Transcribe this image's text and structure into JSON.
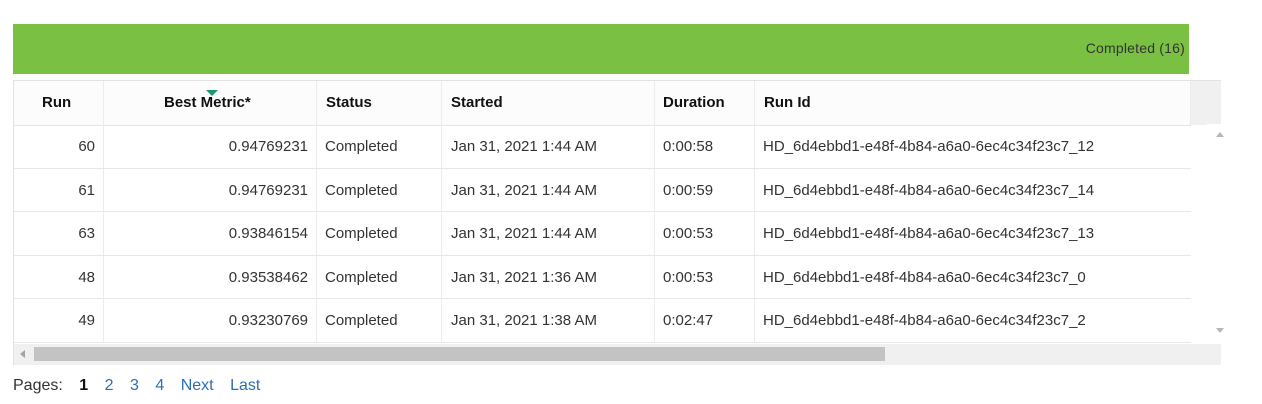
{
  "status_bar": {
    "label": "Completed (16)",
    "color": "#7ac143"
  },
  "table": {
    "columns": [
      "Run",
      "Best Metric*",
      "Status",
      "Started",
      "Duration",
      "Run Id"
    ],
    "sorted_column": "Best Metric*",
    "sort_direction": "descending",
    "rows": [
      {
        "run": "60",
        "metric": "0.94769231",
        "status": "Completed",
        "started": "Jan 31, 2021 1:44 AM",
        "duration": "0:00:58",
        "run_id": "HD_6d4ebbd1-e48f-4b84-a6a0-6ec4c34f23c7_12"
      },
      {
        "run": "61",
        "metric": "0.94769231",
        "status": "Completed",
        "started": "Jan 31, 2021 1:44 AM",
        "duration": "0:00:59",
        "run_id": "HD_6d4ebbd1-e48f-4b84-a6a0-6ec4c34f23c7_14"
      },
      {
        "run": "63",
        "metric": "0.93846154",
        "status": "Completed",
        "started": "Jan 31, 2021 1:44 AM",
        "duration": "0:00:53",
        "run_id": "HD_6d4ebbd1-e48f-4b84-a6a0-6ec4c34f23c7_13"
      },
      {
        "run": "48",
        "metric": "0.93538462",
        "status": "Completed",
        "started": "Jan 31, 2021 1:36 AM",
        "duration": "0:00:53",
        "run_id": "HD_6d4ebbd1-e48f-4b84-a6a0-6ec4c34f23c7_0"
      },
      {
        "run": "49",
        "metric": "0.93230769",
        "status": "Completed",
        "started": "Jan 31, 2021 1:38 AM",
        "duration": "0:02:47",
        "run_id": "HD_6d4ebbd1-e48f-4b84-a6a0-6ec4c34f23c7_2"
      }
    ]
  },
  "pager": {
    "label": "Pages:",
    "current": "1",
    "pages": [
      "2",
      "3",
      "4"
    ],
    "next": "Next",
    "last": "Last"
  },
  "icons": {
    "sort": "sort-descending-icon",
    "scroll_up": "scroll-up-arrow-icon",
    "scroll_down": "scroll-down-arrow-icon",
    "scroll_left": "scroll-left-arrow-icon",
    "scroll_right": "scroll-right-arrow-icon"
  }
}
